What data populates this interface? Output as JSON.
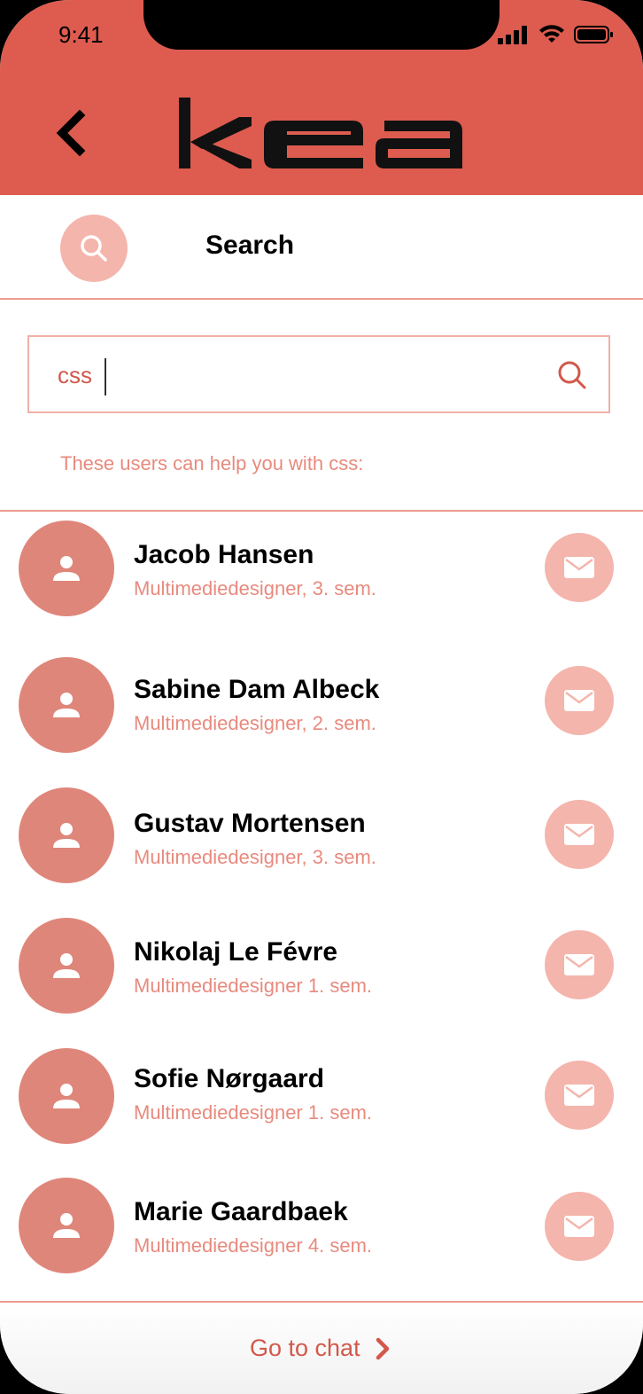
{
  "status_bar": {
    "time": "9:41",
    "icons": [
      "signal-icon",
      "wifi-icon",
      "battery-icon"
    ]
  },
  "header": {
    "back_icon": "chevron-left-icon",
    "logo_text": "kea",
    "background_color": "#dd5c4f"
  },
  "tab": {
    "icon": "search-icon",
    "title": "Search"
  },
  "search": {
    "value": "css",
    "icon": "search-icon"
  },
  "helper_text": "These users can help you with css:",
  "users": [
    {
      "name": "Jacob Hansen",
      "role": "Multimediedesigner, 3. sem."
    },
    {
      "name": "Sabine Dam Albeck",
      "role": "Multimediedesigner, 2. sem."
    },
    {
      "name": "Gustav Mortensen",
      "role": "Multimediedesigner, 3. sem."
    },
    {
      "name": "Nikolaj Le Févre",
      "role": "Multimediedesigner 1. sem."
    },
    {
      "name": "Sofie Nørgaard",
      "role": "Multimediedesigner 1. sem."
    },
    {
      "name": "Marie Gaardbaek",
      "role": "Multimediedesigner 4. sem."
    }
  ],
  "footer": {
    "chat_label": "Go to chat",
    "chat_icon": "chevron-right-icon"
  },
  "colors": {
    "accent": "#d2584b",
    "light_accent": "#f4b5ac",
    "avatar": "#df867b",
    "muted_text": "#e88a7e"
  }
}
